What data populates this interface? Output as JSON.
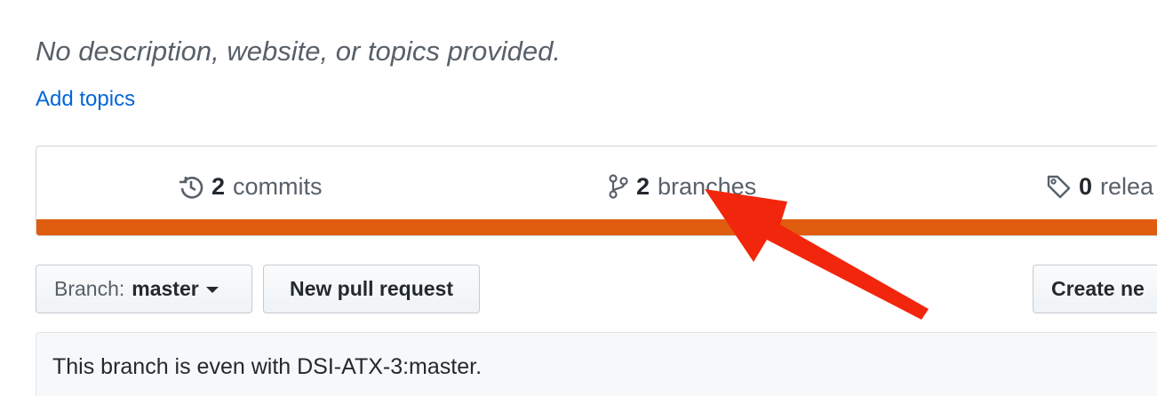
{
  "repo": {
    "description": "No description, website, or topics provided.",
    "add_topics_label": "Add topics"
  },
  "summary": {
    "commits": {
      "count": "2",
      "label": "commits",
      "icon": "history-icon"
    },
    "branches": {
      "count": "2",
      "label": "branches",
      "icon": "git-branch-icon"
    },
    "releases": {
      "count": "0",
      "label": "relea",
      "icon": "tag-icon"
    },
    "language_bar_color": "#e05d0f"
  },
  "toolbar": {
    "branch_prefix": "Branch:",
    "branch_name": "master",
    "new_pull_request_label": "New pull request",
    "create_new_label": "Create ne"
  },
  "status": {
    "message": "This branch is even with DSI-ATX-3:master."
  },
  "annotation": {
    "arrow_color": "#f2260c",
    "arrow_target": "branches"
  }
}
